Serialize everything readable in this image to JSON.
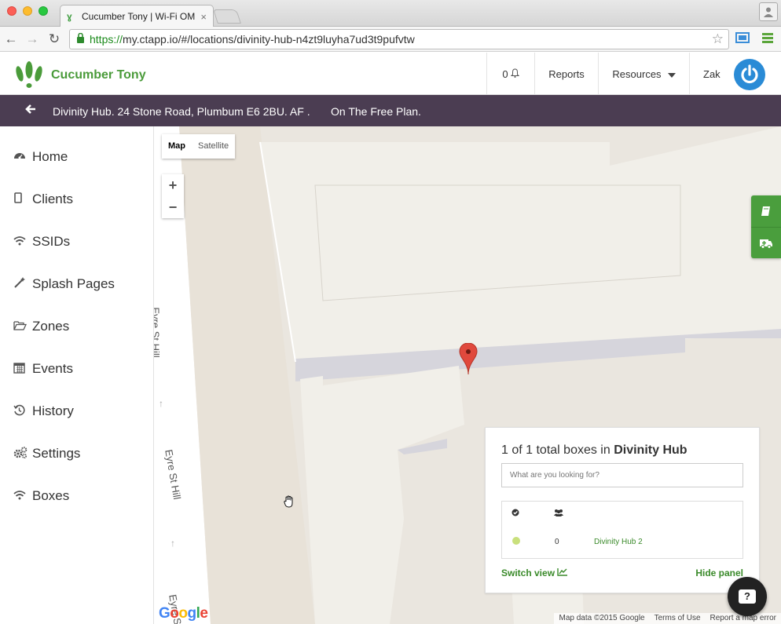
{
  "browser": {
    "tab_title": "Cucumber Tony | Wi-Fi OM",
    "tab_close": "×",
    "url_https": "https://",
    "url_rest": "my.ctapp.io/#/locations/divinity-hub-n4zt9luyha7ud3t9pufvtw"
  },
  "header": {
    "brand": "Cucumber Tony",
    "notifications": "0",
    "reports": "Reports",
    "resources": "Resources",
    "user": "Zak"
  },
  "location_bar": {
    "address": "Divinity Hub. 24 Stone Road, Plumbum E6 2BU. AF .",
    "plan": "On The Free Plan."
  },
  "sidebar": {
    "items": [
      {
        "label": "Home",
        "icon": "dashboard-icon"
      },
      {
        "label": "Clients",
        "icon": "tablet-icon"
      },
      {
        "label": "SSIDs",
        "icon": "wifi-icon"
      },
      {
        "label": "Splash Pages",
        "icon": "magic-wand-icon"
      },
      {
        "label": "Zones",
        "icon": "folder-open-icon"
      },
      {
        "label": "Events",
        "icon": "calendar-icon"
      },
      {
        "label": "History",
        "icon": "history-icon"
      },
      {
        "label": "Settings",
        "icon": "cogs-icon"
      },
      {
        "label": "Boxes",
        "icon": "wifi-icon"
      }
    ]
  },
  "map": {
    "type_map": "Map",
    "type_satellite": "Satellite",
    "zoom_in": "+",
    "zoom_out": "−",
    "street_1": "Eyre St Hill",
    "street_2": "Eyre St Hill",
    "street_3": "Eyre St",
    "google": "Google",
    "map_data": "Map data ©2015 Google",
    "terms": "Terms of Use",
    "report_error": "Report a map error"
  },
  "panel": {
    "title_prefix": "1 of 1 total boxes in ",
    "title_location": "Divinity Hub",
    "search_placeholder": "What are you looking for?",
    "row": {
      "clients": "0",
      "name": "Divinity Hub 2",
      "status_color": "#c9e07c"
    },
    "switch_view": "Switch view",
    "hide_panel": "Hide panel"
  },
  "colors": {
    "brand_green": "#4a9b3a",
    "location_bar": "#4b3d52",
    "avatar_blue": "#2a8bd6"
  }
}
